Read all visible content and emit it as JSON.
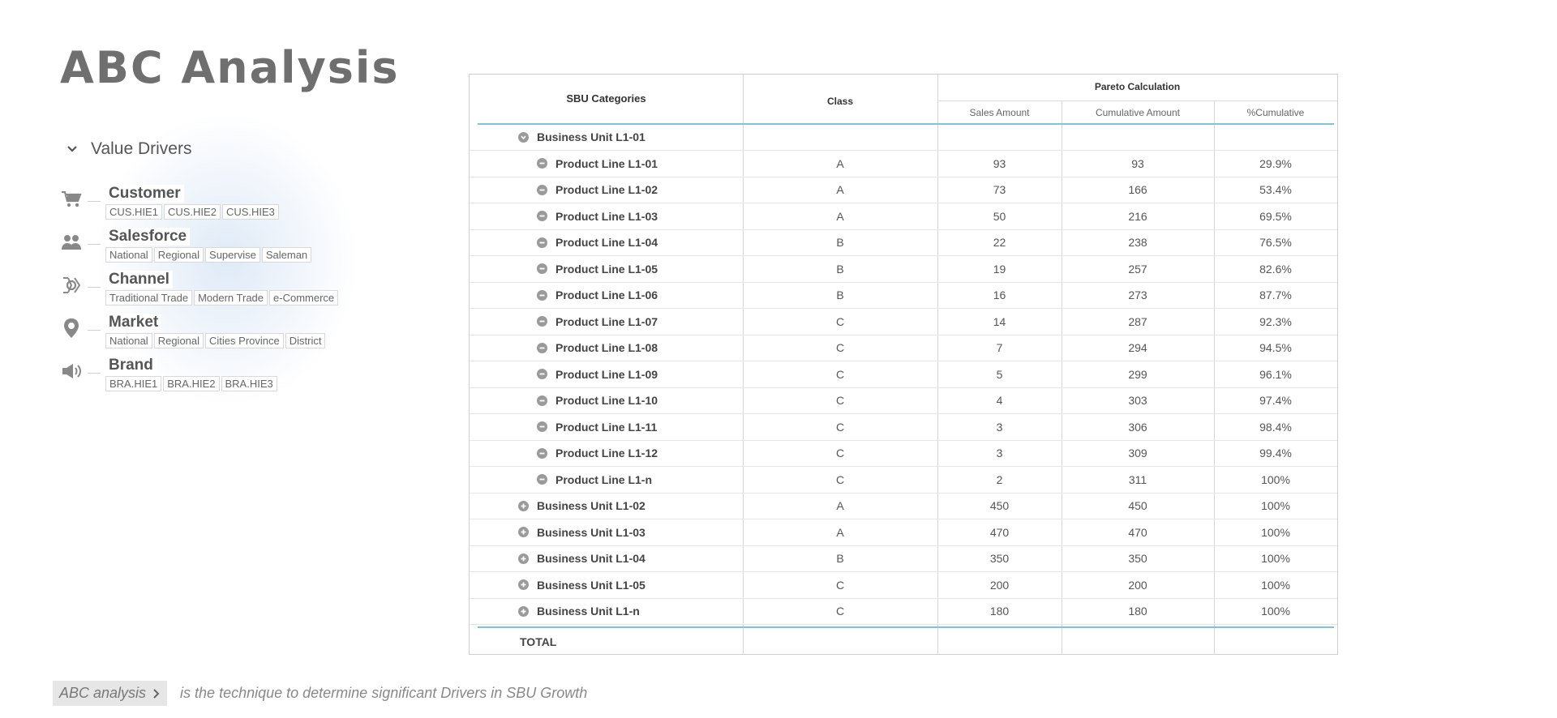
{
  "page": {
    "title": "ABC Analysis"
  },
  "value_drivers": {
    "header": "Value Drivers",
    "items": [
      {
        "name": "Customer",
        "icon": "cart-icon",
        "tags": [
          "CUS.HIE1",
          "CUS.HIE2",
          "CUS.HIE3"
        ]
      },
      {
        "name": "Salesforce",
        "icon": "people-icon",
        "tags": [
          "National",
          "Regional",
          "Supervise",
          "Saleman"
        ]
      },
      {
        "name": "Channel",
        "icon": "channel-icon",
        "tags": [
          "Traditional Trade",
          "Modern Trade",
          "e-Commerce"
        ]
      },
      {
        "name": "Market",
        "icon": "location-pin-icon",
        "tags": [
          "National",
          "Regional",
          "Cities Province",
          "District"
        ]
      },
      {
        "name": "Brand",
        "icon": "megaphone-icon",
        "tags": [
          "BRA.HIE1",
          "BRA.HIE2",
          "BRA.HIE3"
        ]
      }
    ]
  },
  "table": {
    "headers": {
      "sbu": "SBU Categories",
      "class": "Class",
      "pareto": "Pareto Calculation",
      "sales": "Sales Amount",
      "cumulative": "Cumulative Amount",
      "pct": "%Cumulative"
    },
    "rows": [
      {
        "label": "Business Unit L1-01",
        "level": 0,
        "icon": "collapse-icon",
        "class": "",
        "sales": "",
        "cumulative": "",
        "pct": ""
      },
      {
        "label": "Product Line L1-01",
        "level": 1,
        "icon": "minus-icon",
        "class": "A",
        "sales": "93",
        "cumulative": "93",
        "pct": "29.9%"
      },
      {
        "label": "Product Line L1-02",
        "level": 1,
        "icon": "minus-icon",
        "class": "A",
        "sales": "73",
        "cumulative": "166",
        "pct": "53.4%"
      },
      {
        "label": "Product Line L1-03",
        "level": 1,
        "icon": "minus-icon",
        "class": "A",
        "sales": "50",
        "cumulative": "216",
        "pct": "69.5%"
      },
      {
        "label": "Product Line L1-04",
        "level": 1,
        "icon": "minus-icon",
        "class": "B",
        "sales": "22",
        "cumulative": "238",
        "pct": "76.5%"
      },
      {
        "label": "Product Line L1-05",
        "level": 1,
        "icon": "minus-icon",
        "class": "B",
        "sales": "19",
        "cumulative": "257",
        "pct": "82.6%"
      },
      {
        "label": "Product Line L1-06",
        "level": 1,
        "icon": "minus-icon",
        "class": "B",
        "sales": "16",
        "cumulative": "273",
        "pct": "87.7%"
      },
      {
        "label": "Product Line L1-07",
        "level": 1,
        "icon": "minus-icon",
        "class": "C",
        "sales": "14",
        "cumulative": "287",
        "pct": "92.3%"
      },
      {
        "label": "Product Line L1-08",
        "level": 1,
        "icon": "minus-icon",
        "class": "C",
        "sales": "7",
        "cumulative": "294",
        "pct": "94.5%"
      },
      {
        "label": "Product Line L1-09",
        "level": 1,
        "icon": "minus-icon",
        "class": "C",
        "sales": "5",
        "cumulative": "299",
        "pct": "96.1%"
      },
      {
        "label": "Product Line L1-10",
        "level": 1,
        "icon": "minus-icon",
        "class": "C",
        "sales": "4",
        "cumulative": "303",
        "pct": "97.4%"
      },
      {
        "label": "Product Line L1-11",
        "level": 1,
        "icon": "minus-icon",
        "class": "C",
        "sales": "3",
        "cumulative": "306",
        "pct": "98.4%"
      },
      {
        "label": "Product Line L1-12",
        "level": 1,
        "icon": "minus-icon",
        "class": "C",
        "sales": "3",
        "cumulative": "309",
        "pct": "99.4%"
      },
      {
        "label": "Product Line L1-n",
        "level": 1,
        "icon": "minus-icon",
        "class": "C",
        "sales": "2",
        "cumulative": "311",
        "pct": "100%"
      },
      {
        "label": "Business Unit L1-02",
        "level": 0,
        "icon": "plus-icon",
        "class": "A",
        "sales": "450",
        "cumulative": "450",
        "pct": "100%"
      },
      {
        "label": "Business Unit L1-03",
        "level": 0,
        "icon": "plus-icon",
        "class": "A",
        "sales": "470",
        "cumulative": "470",
        "pct": "100%"
      },
      {
        "label": "Business Unit L1-04",
        "level": 0,
        "icon": "plus-icon",
        "class": "B",
        "sales": "350",
        "cumulative": "350",
        "pct": "100%"
      },
      {
        "label": "Business Unit L1-05",
        "level": 0,
        "icon": "plus-icon",
        "class": "C",
        "sales": "200",
        "cumulative": "200",
        "pct": "100%"
      },
      {
        "label": "Business Unit L1-n",
        "level": 0,
        "icon": "plus-icon",
        "class": "C",
        "sales": "180",
        "cumulative": "180",
        "pct": "100%"
      }
    ],
    "total_label": "TOTAL"
  },
  "footer": {
    "pill": "ABC analysis",
    "description": "is the technique to determine significant Drivers in SBU Growth"
  },
  "colors": {
    "accent_line": "#7cc4e0",
    "title": "#6f6f6f",
    "icon": "#8a8a8a"
  }
}
